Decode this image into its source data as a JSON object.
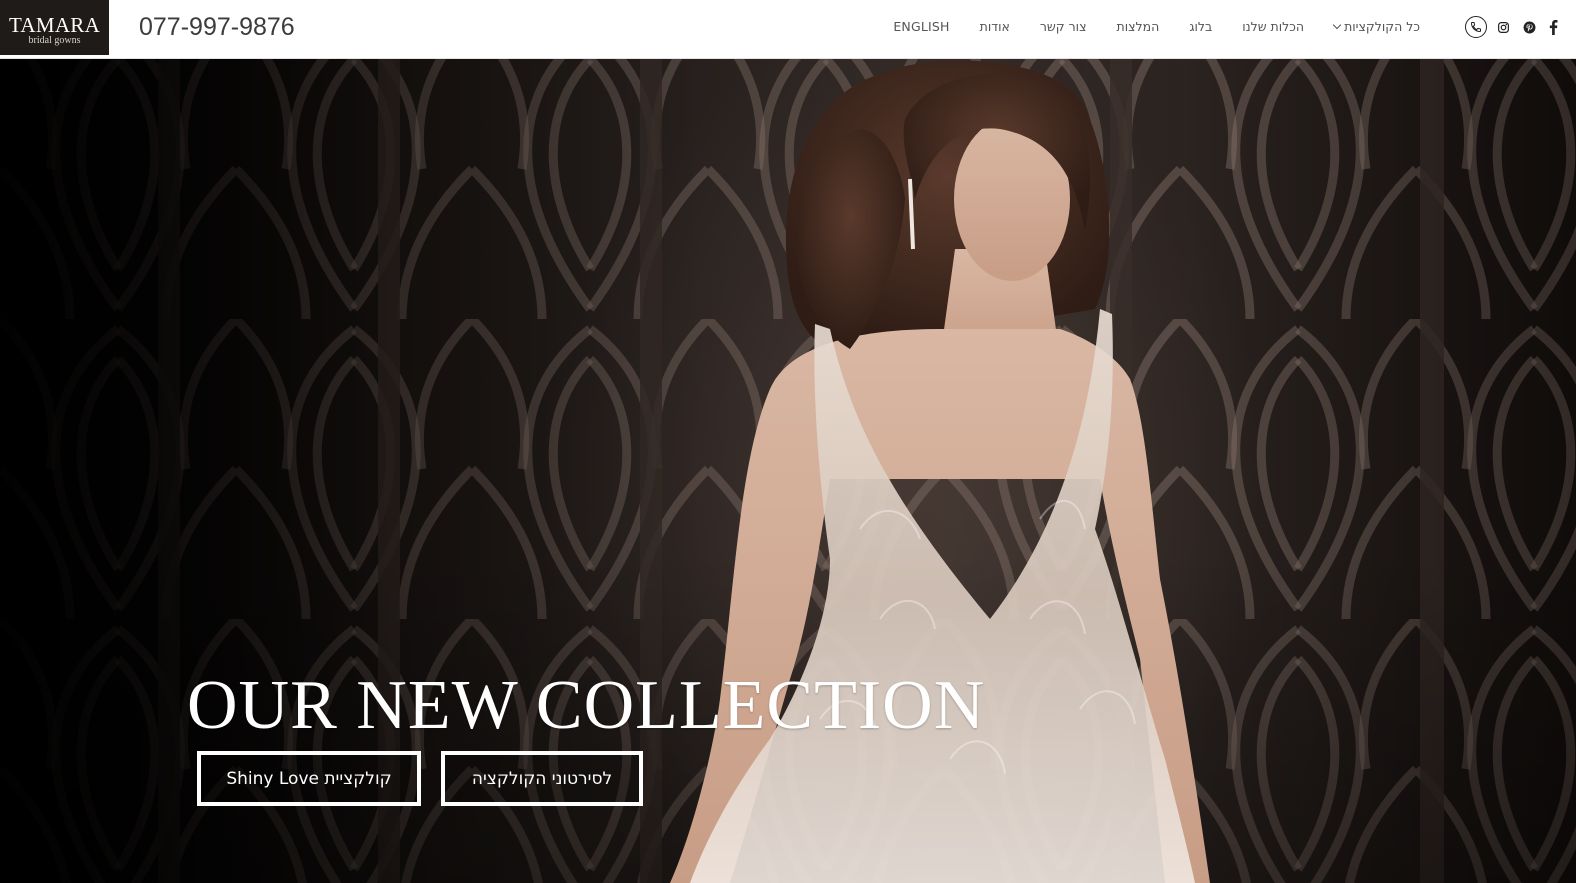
{
  "header": {
    "logo": {
      "name": "TAMARA",
      "tagline": "bridal gowns"
    },
    "phone": "077-997-9876",
    "nav": [
      {
        "label": "כל הקולקציות",
        "has_dropdown": true
      },
      {
        "label": "הכלות שלנו"
      },
      {
        "label": "בלוג"
      },
      {
        "label": "המלצות"
      },
      {
        "label": "צור קשר"
      },
      {
        "label": "אודות"
      },
      {
        "label": "ENGLISH"
      }
    ],
    "social_icons": [
      "phone-icon",
      "instagram-icon",
      "pinterest-icon",
      "facebook-icon"
    ]
  },
  "hero": {
    "title": "OUR NEW COLLECTION",
    "buttons": {
      "collection": "קולקציית Shiny Love",
      "videos": "לסירטוני הקולקציה"
    }
  },
  "colors": {
    "logo_bg": "#1f1b18",
    "text_dark": "#3c3c3c",
    "nav_text": "#555555",
    "hero_dark": "#0c0807",
    "white": "#ffffff"
  }
}
